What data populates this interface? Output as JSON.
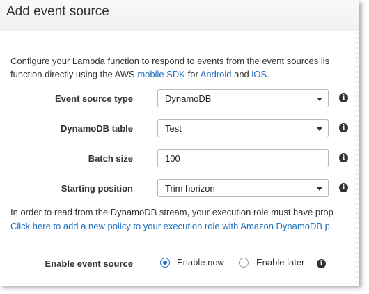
{
  "dialog": {
    "title": "Add event source"
  },
  "description": {
    "line1": "Configure your Lambda function to respond to events from the event sources lis",
    "line2_prefix": "function directly using the AWS ",
    "mobile_sdk_link": "mobile SDK",
    "for_text": " for ",
    "android_link": "Android",
    "and_text": " and ",
    "ios_link": "iOS",
    "period": "."
  },
  "form": {
    "event_source_type": {
      "label": "Event source type",
      "value": "DynamoDB"
    },
    "dynamodb_table": {
      "label": "DynamoDB table",
      "value": "Test"
    },
    "batch_size": {
      "label": "Batch size",
      "value": "100"
    },
    "starting_position": {
      "label": "Starting position",
      "value": "Trim horizon"
    }
  },
  "note": {
    "text": "In order to read from the DynamoDB stream, your execution role must have prop",
    "link": "Click here to add a new policy to your execution role with Amazon DynamoDB p"
  },
  "enable": {
    "label": "Enable event source",
    "option_now": "Enable now",
    "option_later": "Enable later",
    "selected": "now"
  },
  "icons": {
    "info": "i"
  },
  "colors": {
    "link": "#1f6fbf",
    "radio_selected": "#1f6fbf"
  }
}
